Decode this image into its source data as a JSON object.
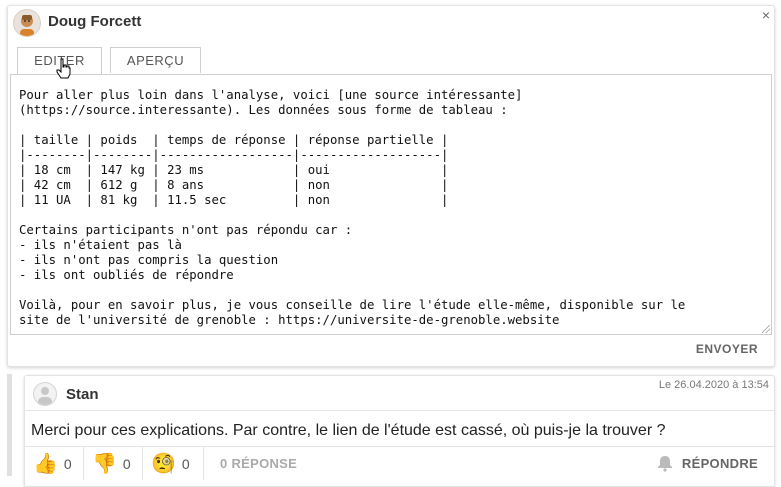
{
  "editor": {
    "user": "Doug Forcett",
    "close_label": "×",
    "tabs": [
      {
        "label": "EDITER"
      },
      {
        "label": "APERÇU"
      }
    ],
    "content": "Pour aller plus loin dans l'analyse, voici [une source intéressante]\n(https://source.interessante). Les données sous forme de tableau :\n\n| taille | poids  | temps de réponse | réponse partielle |\n|--------|--------|------------------|-------------------|\n| 18 cm  | 147 kg | 23 ms            | oui               |\n| 42 cm  | 612 g  | 8 ans            | non               |\n| 11 UA  | 81 kg  | 11.5 sec         | non               |\n\nCertains participants n'ont pas répondu car :\n- ils n'étaient pas là\n- ils n'ont pas compris la question\n- ils ont oubliés de répondre\n\nVoilà, pour en savoir plus, je vous conseille de lire l'étude elle-même, disponible sur le\nsite de l'université de grenoble : https://universite-de-grenoble.website",
    "send_label": "ENVOYER"
  },
  "comment": {
    "user": "Stan",
    "date": "Le 26.04.2020 à 13:54",
    "body": "Merci pour ces explications. Par contre, le lien de l'étude est cassé, où puis-je la trouver ?",
    "reactions": [
      {
        "icon": "thumbs-up-icon",
        "emoji": "👍",
        "count": "0"
      },
      {
        "icon": "thumbs-down-icon",
        "emoji": "👎",
        "count": "0"
      },
      {
        "icon": "thinking-face-icon",
        "emoji": "🧐",
        "count": "0"
      }
    ],
    "replies_label": "0 RÉPONSE",
    "reply_label": "RÉPONDRE"
  }
}
